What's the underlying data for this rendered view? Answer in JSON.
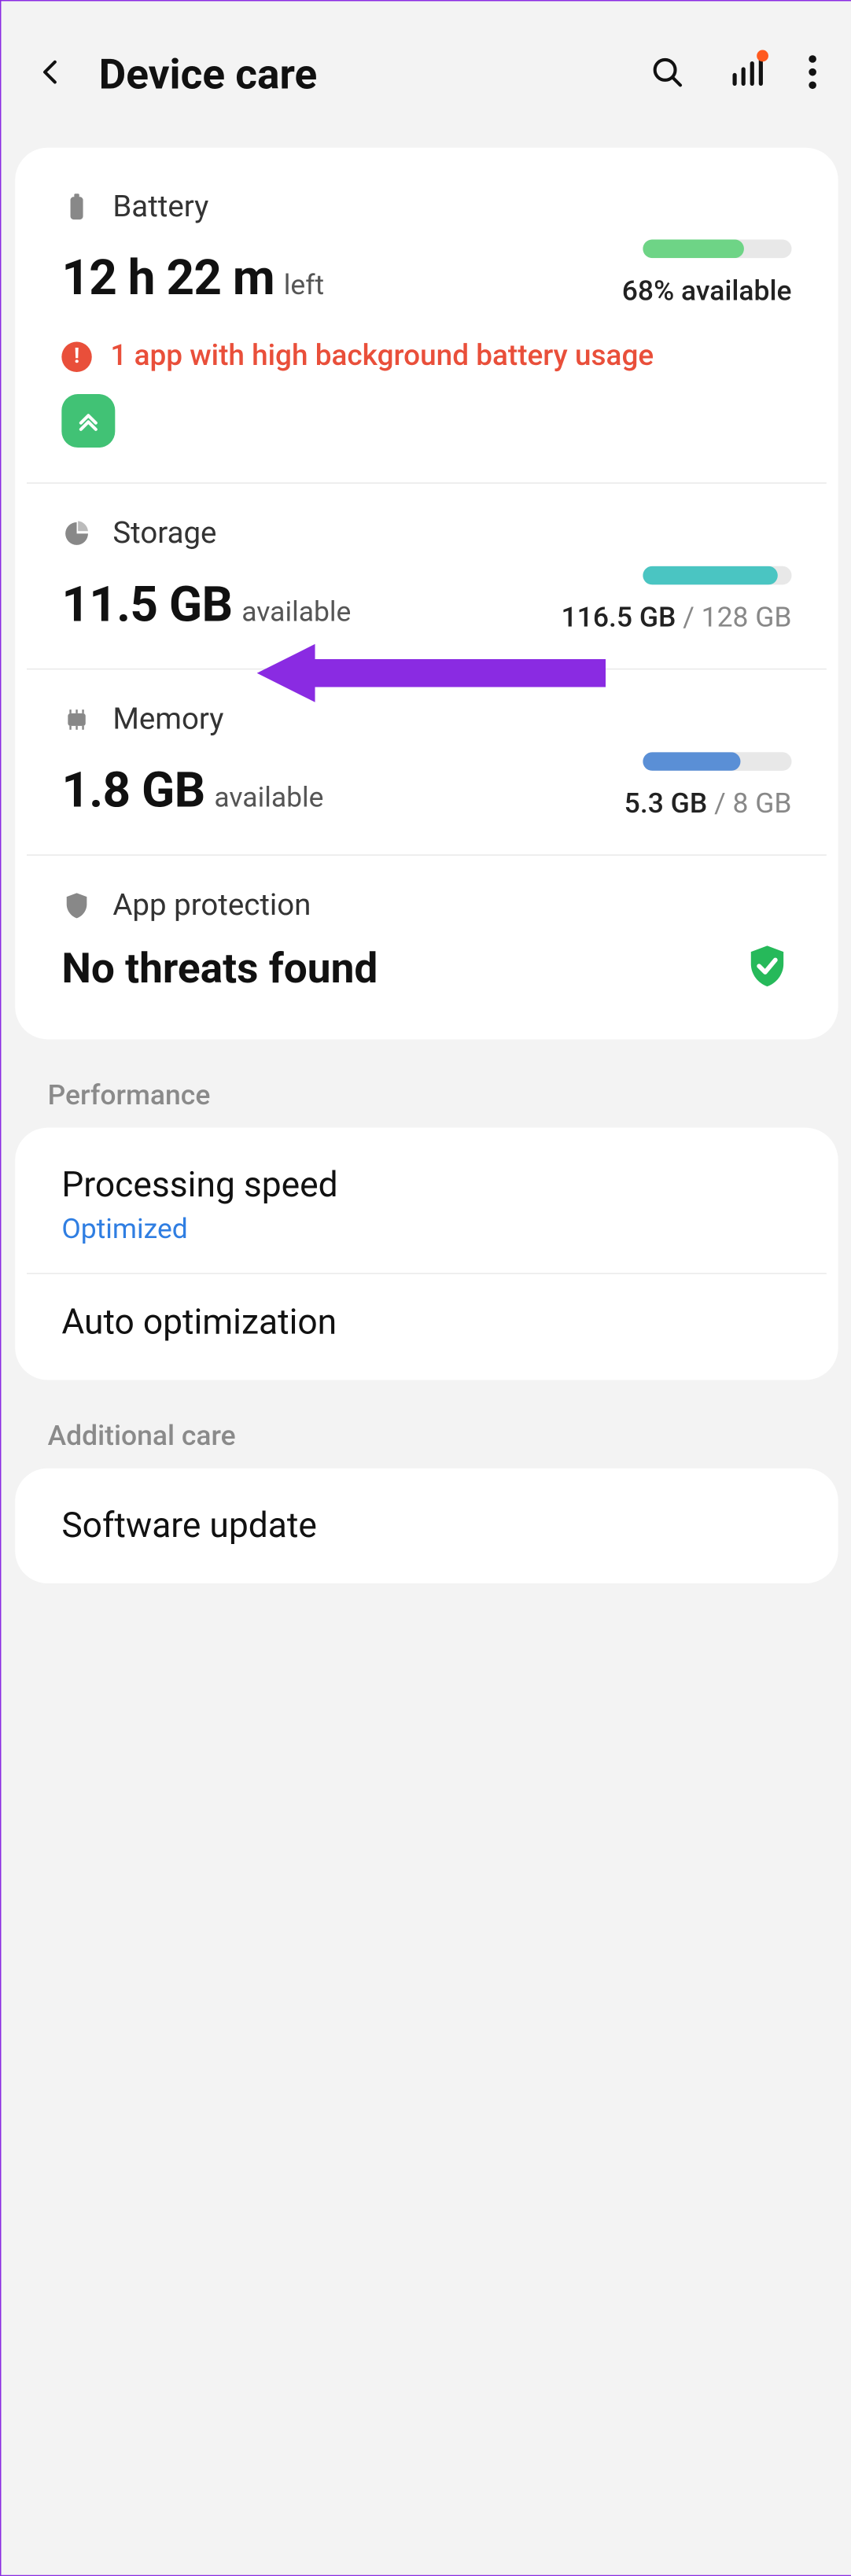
{
  "header": {
    "title": "Device care"
  },
  "battery": {
    "label": "Battery",
    "value": "12 h 22 m",
    "suffix": "left",
    "percent_text": "68% available",
    "warning": "1 app with high background battery usage"
  },
  "storage": {
    "label": "Storage",
    "value": "11.5 GB",
    "suffix": "available",
    "used": "116.5 GB",
    "total": "128 GB"
  },
  "memory": {
    "label": "Memory",
    "value": "1.8 GB",
    "suffix": "available",
    "used": "5.3 GB",
    "total": "8 GB"
  },
  "protection": {
    "label": "App protection",
    "status": "No threats found"
  },
  "groups": {
    "performance": {
      "label": "Performance",
      "processing_title": "Processing speed",
      "processing_sub": "Optimized",
      "auto_title": "Auto optimization"
    },
    "additional": {
      "label": "Additional care",
      "software_title": "Software update"
    }
  }
}
